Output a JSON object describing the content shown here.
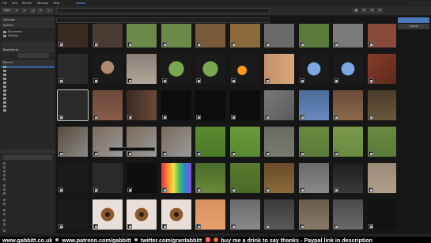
{
  "topbar": {
    "menus": [
      "File",
      "Edit",
      "Render",
      "Window",
      "Help"
    ],
    "active_tab": "",
    "right_items": [
      "",
      ""
    ]
  },
  "toolbar": {
    "view_label": "View",
    "path_value": "",
    "search_placeholder": ""
  },
  "import_panel": {
    "import_button": "",
    "cancel_button": "Cancel"
  },
  "sidebar": {
    "volumes_header": "Volumes",
    "system_header": "System",
    "system_items": [
      "Documents",
      "Desktop"
    ],
    "system_lists_header": "",
    "bookmarks_header": "Bookmarks",
    "add_bookmark": "",
    "recent_header": "Recent",
    "recent_items": [
      "",
      "",
      "",
      "",
      "",
      "",
      "",
      "",
      "",
      "",
      "",
      ""
    ],
    "operator_header": "",
    "operator_presets": "",
    "options": [
      "",
      "",
      "",
      "",
      "",
      "",
      "",
      "",
      "",
      "",
      "",
      "",
      "",
      "",
      "",
      ""
    ]
  },
  "tooltip": "",
  "status": "",
  "banner": {
    "segments": [
      "www.gabbitt.co.uk",
      "www.patreon.com/gabbitt",
      "twitter.com/grantabbitt",
      "buy me a drink to say thanks - Paypal link in description"
    ]
  },
  "colors": {
    "accent": "#3a5a8a",
    "banner_text": "#ffffff"
  }
}
